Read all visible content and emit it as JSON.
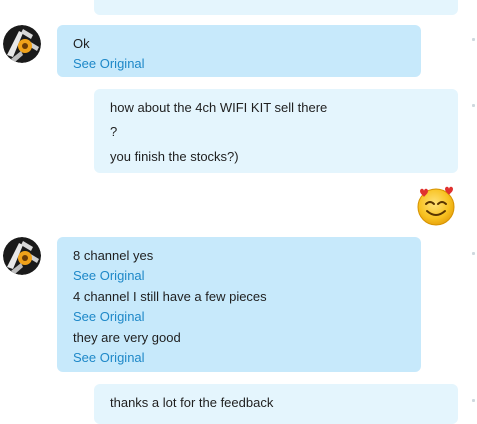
{
  "messages": [
    {
      "side": "incoming",
      "lines": [
        "Ok"
      ],
      "see_original": "See Original"
    },
    {
      "side": "outgoing",
      "lines": [
        "how about the 4ch WIFI KIT sell there",
        "?",
        "you finish the stocks?)"
      ]
    },
    {
      "side": "incoming",
      "lines": [
        "8 channel yes",
        "4 channel I still have a few pieces",
        "they are very good"
      ],
      "see_original": "See Original"
    },
    {
      "side": "outgoing",
      "lines": [
        "thanks a lot for the feedback"
      ]
    }
  ],
  "emoticon": {
    "name": "in-love-smiley-icon"
  },
  "avatar": {
    "name": "contact-avatar-icon"
  },
  "colors": {
    "incoming_bubble": "#c7e9fb",
    "outgoing_bubble": "#e4f5fd",
    "link": "#1e88c8"
  }
}
